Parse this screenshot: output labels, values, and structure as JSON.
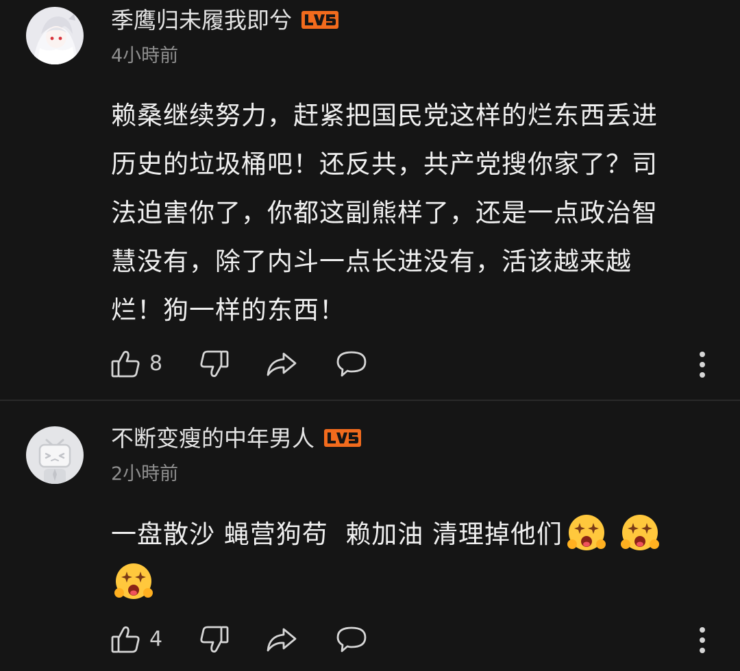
{
  "comments": [
    {
      "username": "季鹰归未履我即兮",
      "level": "LV5",
      "time": "4小時前",
      "lines": [
        "赖桑继续努力，赶紧把国民党这样的烂东西丢进",
        "历史的垃圾桶吧！还反共，共产党搜你家了？司",
        "法迫害你了，你都这副熊样了，还是一点政治智",
        "慧没有，除了内斗一点长进没有，活该越来越",
        "烂！狗一样的东西！"
      ],
      "likes": "8"
    },
    {
      "username": "不断变瘦的中年男人",
      "level": "LV5",
      "time": "2小時前",
      "text": "一盘散沙 蝇营狗苟  赖加油 清理掉他们",
      "emoji": "starstruck-face-emoji",
      "likes": "4"
    }
  ],
  "icons": {
    "like": "thumbs-up-icon",
    "dislike": "thumbs-down-icon",
    "share": "share-icon",
    "reply": "reply-icon",
    "more": "more-vertical-icon"
  },
  "colors": {
    "background": "#151515",
    "level_badge": "#f26b1d",
    "text": "#f0f0f0",
    "muted": "#8f8f8f"
  }
}
